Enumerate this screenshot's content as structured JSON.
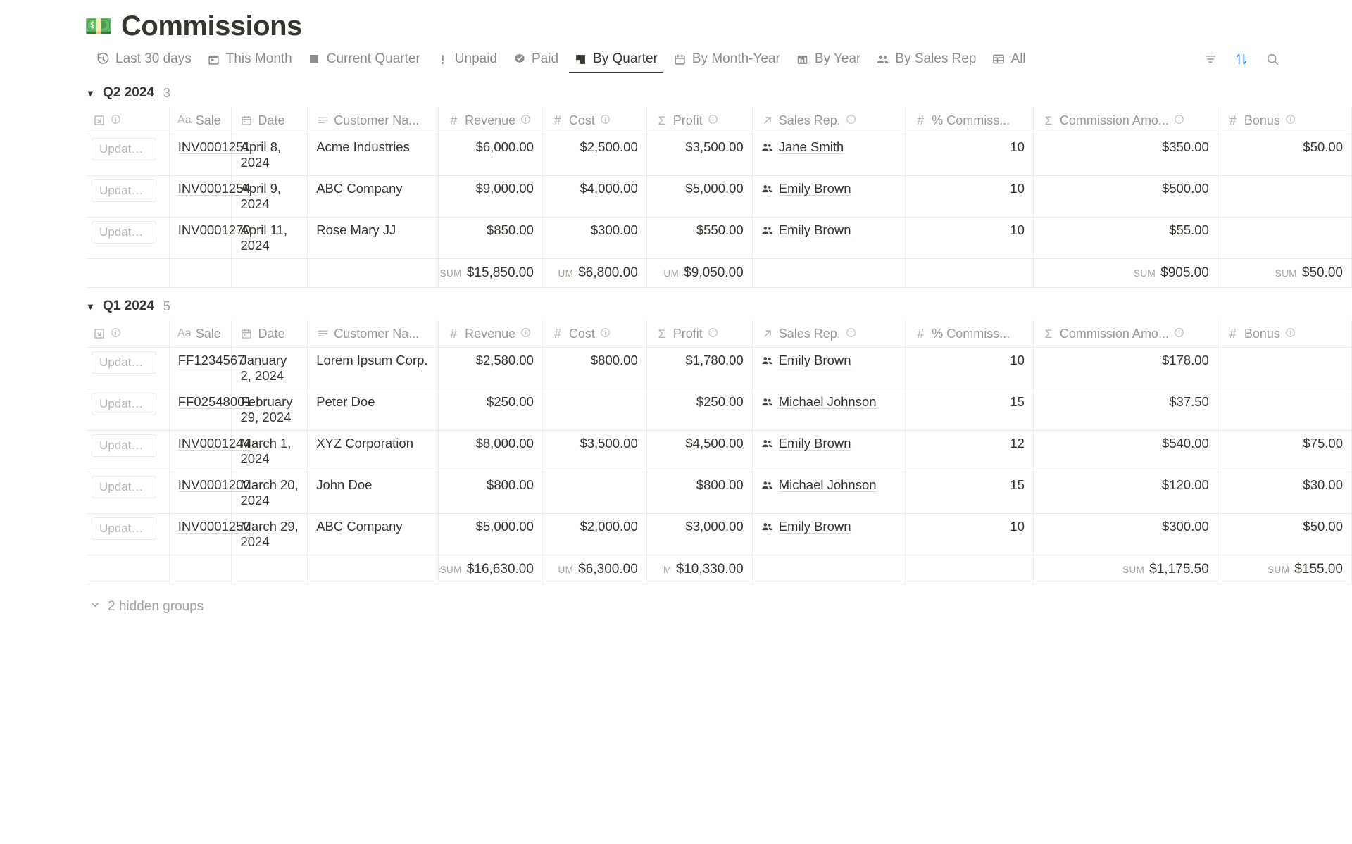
{
  "header": {
    "emoji": "💵",
    "emoji_name": "banknote-emoji",
    "title": "Commissions"
  },
  "tabs": [
    {
      "label": "Last 30 days",
      "icon": "history-icon",
      "active": false
    },
    {
      "label": "This Month",
      "icon": "calendar-icon",
      "active": false
    },
    {
      "label": "Current Quarter",
      "icon": "square-icon",
      "active": false
    },
    {
      "label": "Unpaid",
      "icon": "exclamation-icon",
      "active": false
    },
    {
      "label": "Paid",
      "icon": "check-badge-icon",
      "active": false
    },
    {
      "label": "By Quarter",
      "icon": "dog-eared-page-icon",
      "active": true
    },
    {
      "label": "By Month-Year",
      "icon": "calendar-icon",
      "active": false
    },
    {
      "label": "By Year",
      "icon": "calendar-grid-icon",
      "active": false
    },
    {
      "label": "By Sales Rep",
      "icon": "people-icon",
      "active": false
    },
    {
      "label": "All",
      "icon": "table-icon",
      "active": false
    }
  ],
  "toolbar": {
    "filter_label": "Filter",
    "sort_label": "Sort",
    "search_label": "Search",
    "sort_active_color": "#2383e2",
    "icon_color": "#9b9a96"
  },
  "columns": [
    {
      "key": "open",
      "label": "",
      "icon": "open-page-icon",
      "align": "left",
      "info": true
    },
    {
      "key": "sale",
      "label": "Sale",
      "icon": "text-aa-icon",
      "align": "left",
      "info": false
    },
    {
      "key": "date",
      "label": "Date",
      "icon": "calendar-icon",
      "align": "left",
      "info": false
    },
    {
      "key": "cust",
      "label": "Customer Na...",
      "icon": "text-lines-icon",
      "align": "left",
      "info": false
    },
    {
      "key": "rev",
      "label": "Revenue",
      "icon": "number-hash-icon",
      "align": "left",
      "info": true
    },
    {
      "key": "cost",
      "label": "Cost",
      "icon": "number-hash-icon",
      "align": "left",
      "info": true
    },
    {
      "key": "prof",
      "label": "Profit",
      "icon": "sigma-icon",
      "align": "left",
      "info": true
    },
    {
      "key": "rep",
      "label": "Sales Rep.",
      "icon": "relation-arrow-icon",
      "align": "left",
      "info": true
    },
    {
      "key": "pct",
      "label": "% Commiss...",
      "icon": "number-hash-icon",
      "align": "left",
      "info": false
    },
    {
      "key": "amt",
      "label": "Commission Amo...",
      "icon": "sigma-icon",
      "align": "left",
      "info": true
    },
    {
      "key": "bon",
      "label": "Bonus",
      "icon": "number-hash-icon",
      "align": "left",
      "info": true
    }
  ],
  "row_button_label": "Update as ...",
  "groups": [
    {
      "name": "Q2 2024",
      "count": "3",
      "expanded": true,
      "rows": [
        {
          "sale": "INV0001251",
          "date": "April 8, 2024",
          "cust": "Acme Industries",
          "rev": "$6,000.00",
          "cost": "$2,500.00",
          "prof": "$3,500.00",
          "rep": "Jane Smith",
          "pct": "10",
          "amt": "$350.00",
          "bon": "$50.00"
        },
        {
          "sale": "INV0001254",
          "date": "April 9, 2024",
          "cust": "ABC Company",
          "rev": "$9,000.00",
          "cost": "$4,000.00",
          "prof": "$5,000.00",
          "rep": "Emily Brown",
          "pct": "10",
          "amt": "$500.00",
          "bon": ""
        },
        {
          "sale": "INV0001270",
          "date": "April 11, 2024",
          "cust": "Rose Mary JJ",
          "rev": "$850.00",
          "cost": "$300.00",
          "prof": "$550.00",
          "rep": "Emily Brown",
          "pct": "10",
          "amt": "$55.00",
          "bon": ""
        }
      ],
      "summary": {
        "rev": {
          "label": "SUM",
          "value": "$15,850.00"
        },
        "cost": {
          "label": "UM",
          "value": "$6,800.00"
        },
        "prof": {
          "label": "UM",
          "value": "$9,050.00"
        },
        "amt": {
          "label": "SUM",
          "value": "$905.00"
        },
        "bon": {
          "label": "SUM",
          "value": "$50.00"
        }
      }
    },
    {
      "name": "Q1 2024",
      "count": "5",
      "expanded": true,
      "rows": [
        {
          "sale": "FF1234567",
          "date": "January 2, 2024",
          "cust": "Lorem Ipsum Corp.",
          "rev": "$2,580.00",
          "cost": "$800.00",
          "prof": "$1,780.00",
          "rep": "Emily Brown",
          "pct": "10",
          "amt": "$178.00",
          "bon": ""
        },
        {
          "sale": "FF02548001",
          "date": "February 29, 2024",
          "cust": "Peter Doe",
          "rev": "$250.00",
          "cost": "",
          "prof": "$250.00",
          "rep": "Michael Johnson",
          "pct": "15",
          "amt": "$37.50",
          "bon": ""
        },
        {
          "sale": "INV0001244",
          "date": "March 1, 2024",
          "cust": "XYZ Corporation",
          "rev": "$8,000.00",
          "cost": "$3,500.00",
          "prof": "$4,500.00",
          "rep": "Emily Brown",
          "pct": "12",
          "amt": "$540.00",
          "bon": "$75.00"
        },
        {
          "sale": "INV0001200",
          "date": "March 20, 2024",
          "cust": "John Doe",
          "rev": "$800.00",
          "cost": "",
          "prof": "$800.00",
          "rep": "Michael Johnson",
          "pct": "15",
          "amt": "$120.00",
          "bon": "$30.00"
        },
        {
          "sale": "INV0001250",
          "date": "March 29, 2024",
          "cust": "ABC Company",
          "rev": "$5,000.00",
          "cost": "$2,000.00",
          "prof": "$3,000.00",
          "rep": "Emily Brown",
          "pct": "10",
          "amt": "$300.00",
          "bon": "$50.00"
        }
      ],
      "summary": {
        "rev": {
          "label": "SUM",
          "value": "$16,630.00"
        },
        "cost": {
          "label": "UM",
          "value": "$6,300.00"
        },
        "prof": {
          "label": "M",
          "value": "$10,330.00"
        },
        "amt": {
          "label": "SUM",
          "value": "$1,175.50"
        },
        "bon": {
          "label": "SUM",
          "value": "$155.00"
        }
      }
    }
  ],
  "hidden_groups": {
    "label": "2 hidden groups"
  }
}
